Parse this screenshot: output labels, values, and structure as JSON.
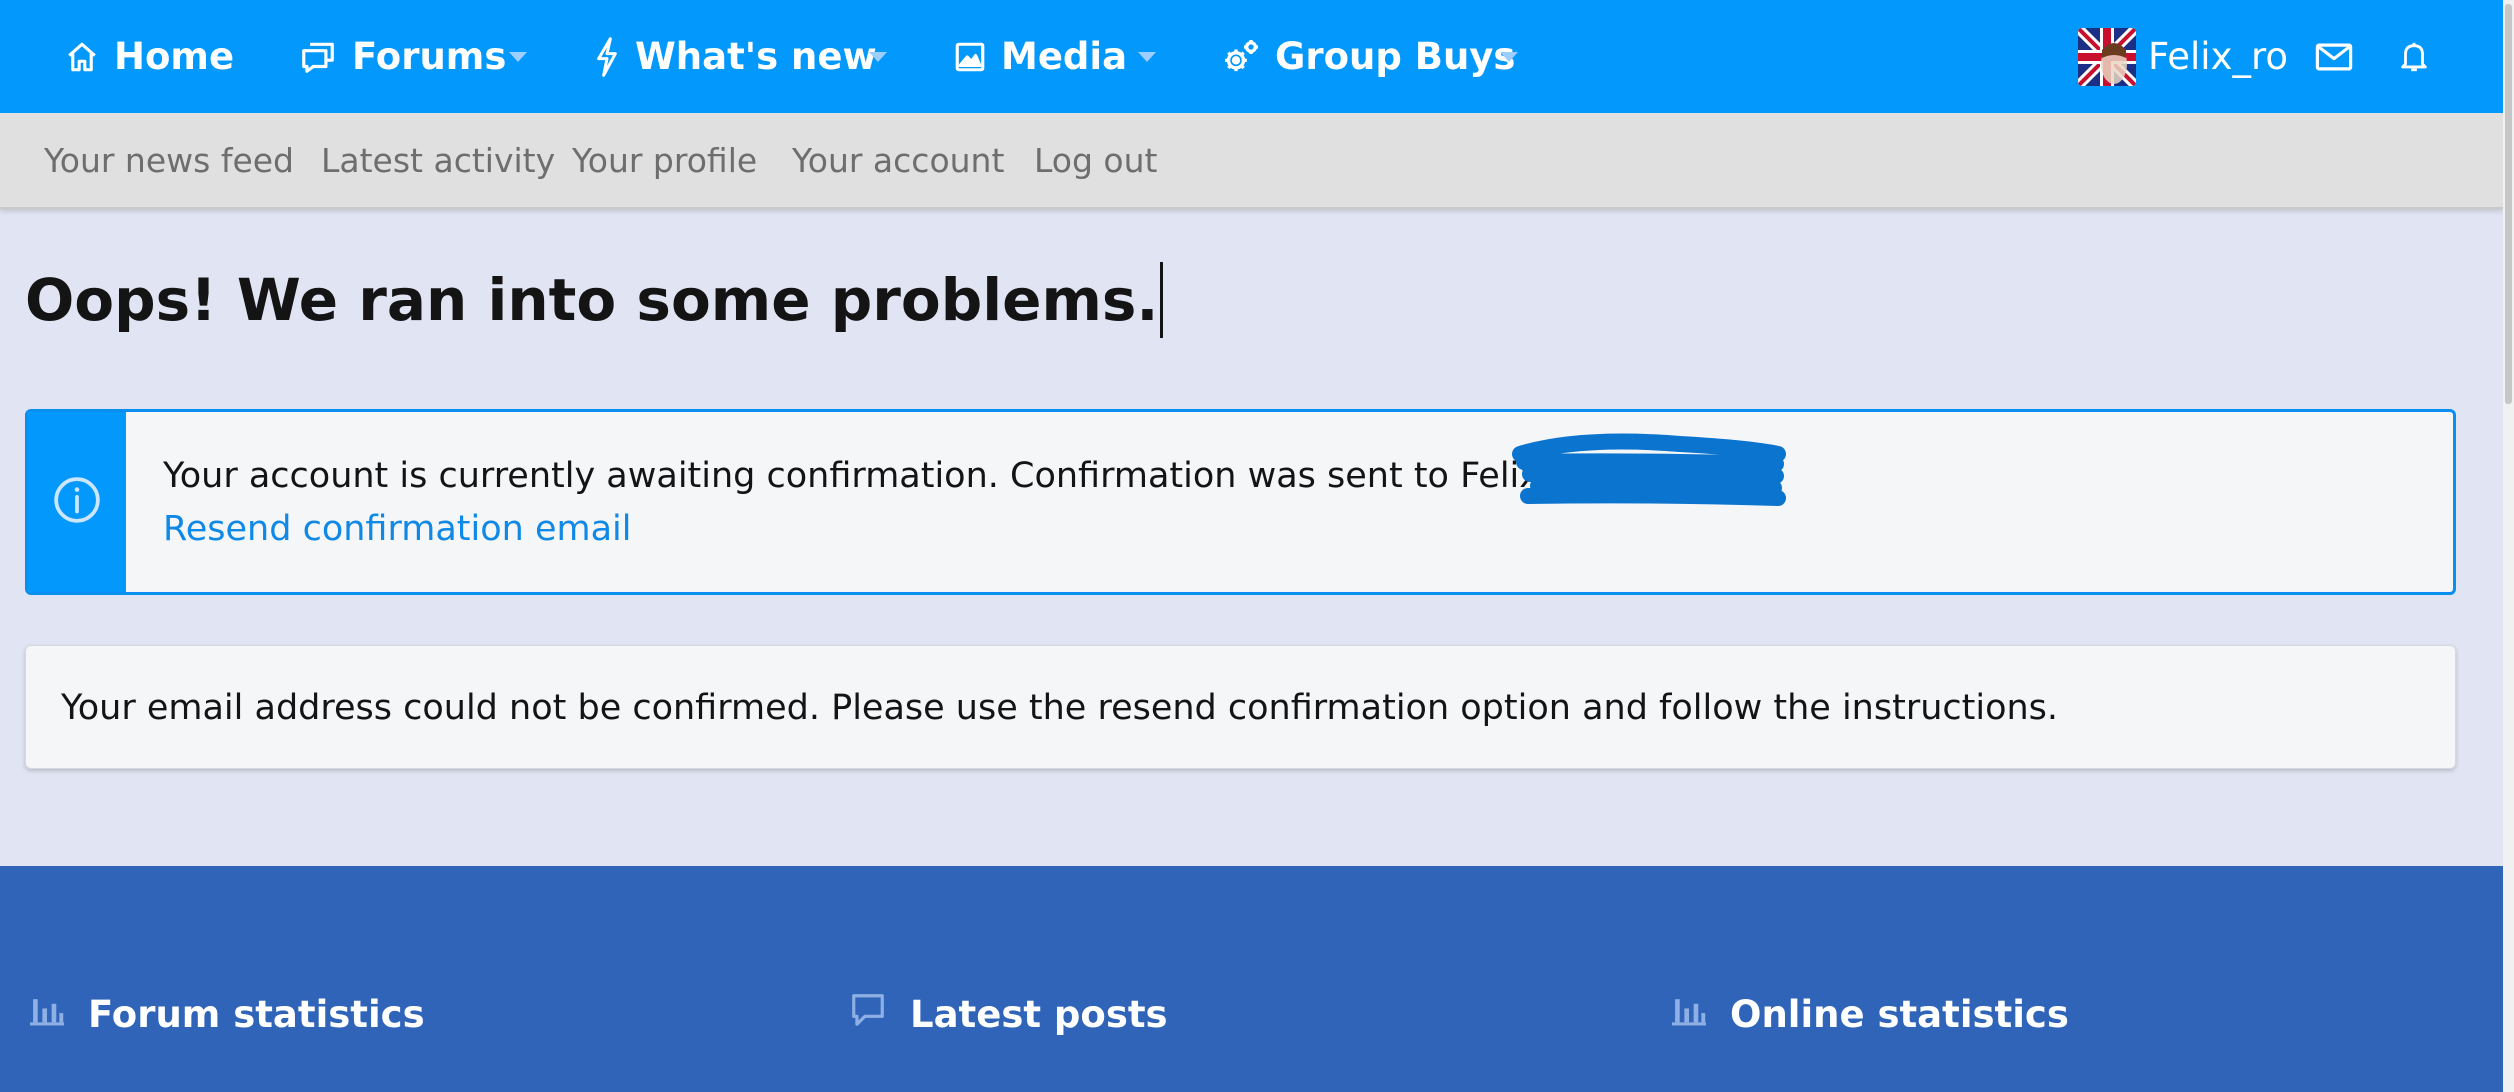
{
  "colors": {
    "topnav_bg": "#0398fb",
    "subnav_bg": "#e0e0e0",
    "page_bg": "#e1e5f3",
    "notice_accent": "#0398fb",
    "link": "#1089e6",
    "footer_bg": "#2f64b9"
  },
  "topnav": {
    "items": [
      {
        "label": "Home",
        "icon": "home-icon"
      },
      {
        "label": "Forums",
        "icon": "chat-icon"
      },
      {
        "label": "What's new",
        "icon": "bolt-icon"
      },
      {
        "label": "Media",
        "icon": "image-icon"
      },
      {
        "label": "Group Buys",
        "icon": "gears-icon"
      }
    ],
    "username": "Felix_ro"
  },
  "subnav": {
    "links": [
      "Your news feed",
      "Latest activity",
      "Your profile",
      "Your account",
      "Log out"
    ]
  },
  "main": {
    "title": "Oops! We ran into some problems.",
    "notice": {
      "message": "Your account is currently awaiting confirmation. Confirmation was sent to Felix_ro",
      "link": "Resend confirmation email"
    },
    "error_message": "Your email address could not be confirmed. Please use the resend confirmation option and follow the instructions."
  },
  "footer": {
    "sections": [
      {
        "label": "Forum statistics",
        "icon": "bar-chart-icon"
      },
      {
        "label": "Latest posts",
        "icon": "comment-icon"
      },
      {
        "label": "Online statistics",
        "icon": "bar-chart-icon"
      }
    ]
  }
}
